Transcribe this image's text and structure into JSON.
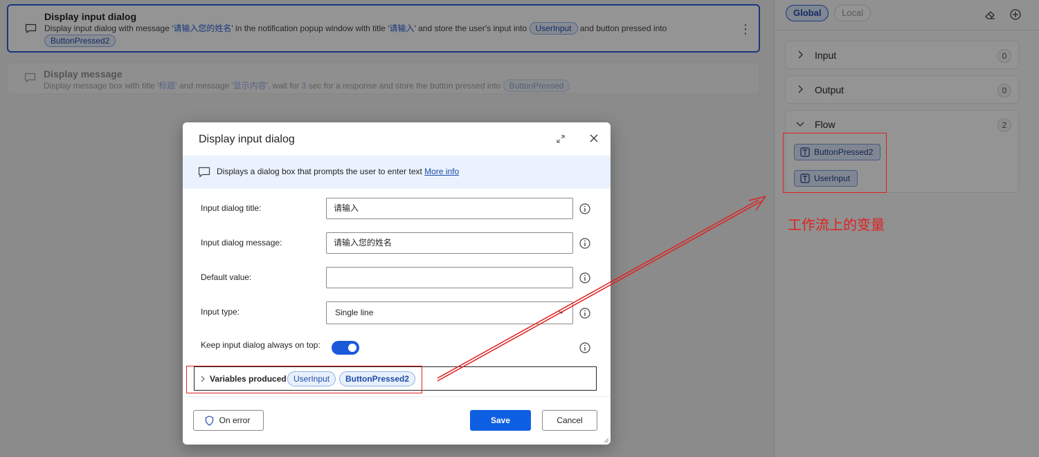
{
  "canvas": {
    "action1": {
      "title": "Display input dialog",
      "desc_a": "Display input dialog with message '",
      "msg": "请输入您的姓名",
      "desc_b": "' in the notification popup window with title '",
      "title_val": "请输入",
      "desc_c": "' and store the user's input into",
      "var1": "UserInput",
      "desc_d": "and button pressed into",
      "var2": "ButtonPressed2",
      "kebab": "⋮"
    },
    "action2": {
      "title": "Display message",
      "desc_a": "Display message box with title '",
      "title_val": "标题",
      "desc_b": "' and message '",
      "msg": "显示内容",
      "desc_c": "', wait for",
      "secs": "3",
      "desc_d": "sec for a response and store the button pressed into",
      "var1": "ButtonPressed"
    }
  },
  "vpanel": {
    "tab_global": "Global",
    "tab_local": "Local",
    "sections": [
      {
        "title": "Input",
        "count": "0"
      },
      {
        "title": "Output",
        "count": "0"
      },
      {
        "title": "Flow",
        "count": "2"
      }
    ],
    "flow_vars": [
      "ButtonPressed2",
      "UserInput"
    ],
    "annotation": "工作流上的变量"
  },
  "dialog": {
    "title": "Display input dialog",
    "info_text": "Displays a dialog box that prompts the user to enter text",
    "info_link": "More info",
    "fields": {
      "title_label": "Input dialog title:",
      "title_value": "请输入",
      "message_label": "Input dialog message:",
      "message_value": "请输入您的姓名",
      "default_label": "Default value:",
      "default_value": "",
      "type_label": "Input type:",
      "type_value": "Single line",
      "ontop_label": "Keep input dialog always on top:"
    },
    "vars_produced_label": "Variables produced",
    "vars_produced": [
      "UserInput",
      "ButtonPressed2"
    ],
    "on_error": "On error",
    "save": "Save",
    "cancel": "Cancel"
  },
  "colors": {
    "accent": "#0f5fe3",
    "annotation_red": "#e02020",
    "chip_bg": "#e8f0fc"
  }
}
